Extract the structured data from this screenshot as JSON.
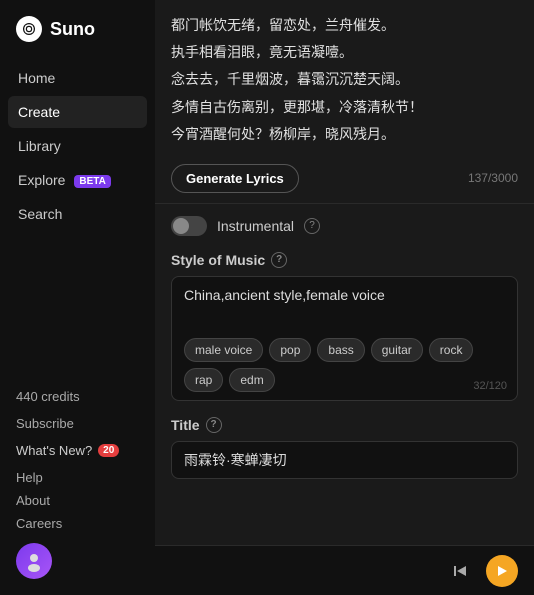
{
  "sidebar": {
    "logo_text": "Suno",
    "nav_items": [
      {
        "id": "home",
        "label": "Home",
        "active": false
      },
      {
        "id": "create",
        "label": "Create",
        "active": true
      },
      {
        "id": "library",
        "label": "Library",
        "active": false
      },
      {
        "id": "explore",
        "label": "Explore",
        "active": false,
        "badge": "BETA"
      },
      {
        "id": "search",
        "label": "Search",
        "active": false
      }
    ],
    "credits": "440 credits",
    "subscribe": "Subscribe",
    "whats_new": "What's New?",
    "notification_count": "20",
    "help": "Help",
    "about": "About",
    "careers": "Careers"
  },
  "lyrics": {
    "lines": [
      "都门帐饮无绪，留恋处，兰舟催发。",
      "执手相看泪眼，竟无语凝噎。",
      "念去去，千里烟波，暮霭沉沉楚天阔。",
      "多情自古伤离别，更那堪，冷落清秋节！",
      "今宵酒醒何处？杨柳岸，晓风残月。"
    ]
  },
  "generate_lyrics": {
    "button_label": "Generate Lyrics",
    "char_count": "137/3000"
  },
  "instrumental": {
    "label": "Instrumental",
    "enabled": false
  },
  "style_of_music": {
    "label": "Style of Music",
    "value": "China,ancient style,female voice",
    "tags": [
      "male voice",
      "pop",
      "bass",
      "guitar",
      "rock",
      "rap",
      "edm"
    ],
    "char_count": "32/120"
  },
  "title": {
    "label": "Title",
    "value": "雨霖铃·寒蝉凄切"
  },
  "player": {
    "skip_back_icon": "⏮",
    "play_icon": "▶"
  },
  "icons": {
    "help_question": "?",
    "logo_symbol": "♪"
  }
}
